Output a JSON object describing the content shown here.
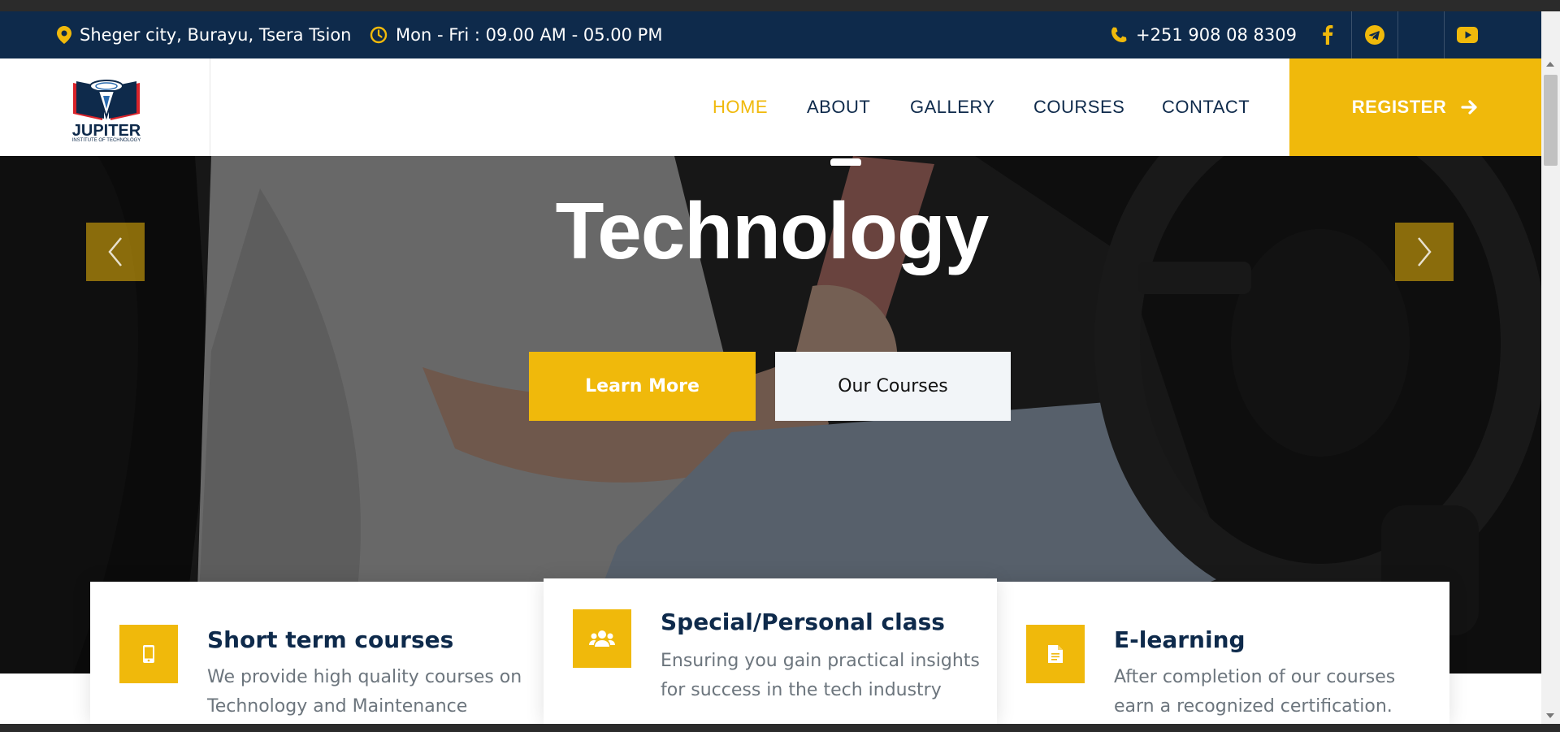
{
  "topbar": {
    "address": "Sheger city, Burayu, Tsera Tsion",
    "hours": "Mon - Fri : 09.00 AM - 05.00 PM",
    "phone": "+251 908 08 8309",
    "social_icons": [
      "facebook-icon",
      "telegram-icon",
      "blank-social-slot",
      "youtube-icon"
    ]
  },
  "brand": {
    "name": "JUPITER",
    "tagline": "INSTITUTE OF TECHNOLOGY"
  },
  "nav": {
    "items": [
      {
        "label": "HOME",
        "active": true
      },
      {
        "label": "ABOUT",
        "active": false
      },
      {
        "label": "GALLERY",
        "active": false
      },
      {
        "label": "COURSES",
        "active": false
      },
      {
        "label": "CONTACT",
        "active": false
      }
    ],
    "register_label": "REGISTER"
  },
  "hero": {
    "title": "Technology",
    "learn_more_label": "Learn More",
    "our_courses_label": "Our Courses"
  },
  "features": [
    {
      "title": "Short term courses",
      "description": "We provide high quality courses on Technology and Maintenance",
      "icon": "mobile-phone-icon"
    },
    {
      "title": "Special/Personal class",
      "description": "Ensuring you gain practical insights for success in the tech industry",
      "icon": "users-icon"
    },
    {
      "title": "E-learning",
      "description": "After completion of our courses earn a recognized certification.",
      "icon": "document-icon"
    }
  ],
  "colors": {
    "navy": "#0e2a4b",
    "accent": "#f0b90b",
    "light_button": "#f2f5f8"
  }
}
